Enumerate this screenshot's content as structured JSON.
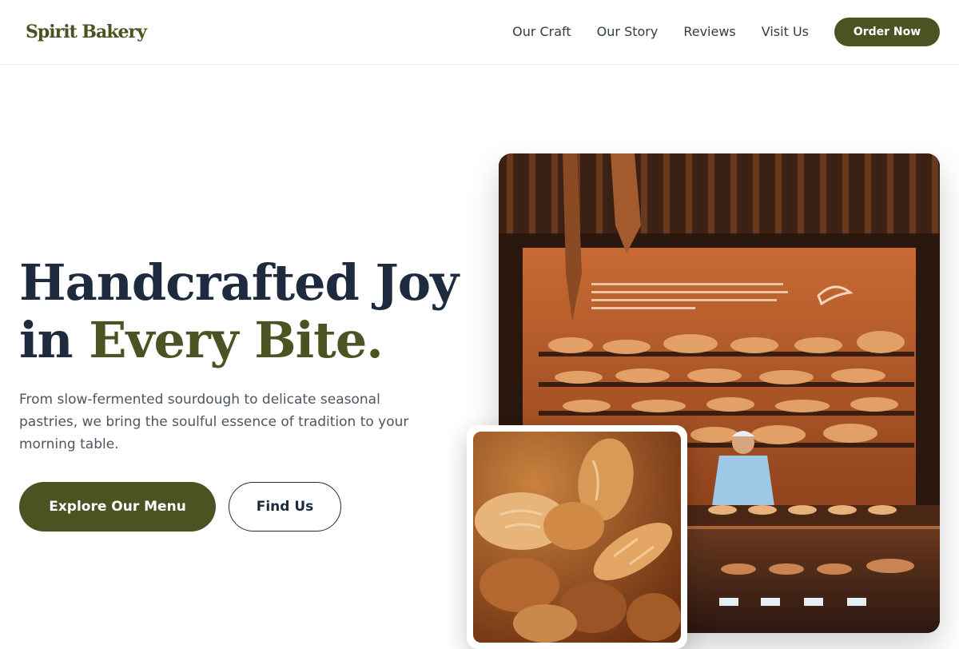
{
  "header": {
    "brand": "Spirit Bakery",
    "nav": [
      "Our Craft",
      "Our Story",
      "Reviews",
      "Visit Us"
    ],
    "cta_label": "Order Now"
  },
  "hero": {
    "title_line1": "Handcrafted Joy",
    "title_line2_prefix": "in ",
    "title_line2_accent": "Every Bite.",
    "subtitle": "From slow-fermented sourdough to delicate seasonal pastries, we bring the soulful essence of tradition to your morning table.",
    "primary_button": "Explore Our Menu",
    "secondary_button": "Find Us"
  },
  "images": {
    "main_photo": "bakery interior with bread shelves and baker",
    "inset_photo": "assorted artisan bread loaves"
  },
  "colors": {
    "brand_olive": "#4a5423",
    "heading_navy": "#1e2a3d",
    "body_gray": "#4d5560"
  }
}
